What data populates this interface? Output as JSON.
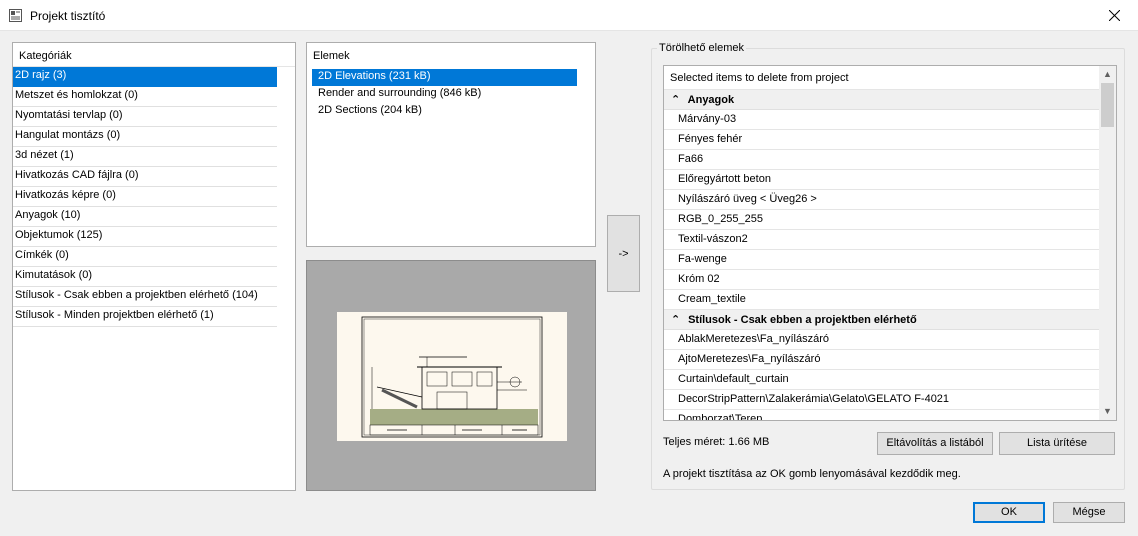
{
  "window": {
    "title": "Projekt tisztító",
    "close_icon": "close-icon"
  },
  "categories": {
    "header": "Kategóriák",
    "items": [
      "2D rajz (3)",
      "Metszet és homlokzat (0)",
      "Nyomtatási tervlap (0)",
      "Hangulat montázs (0)",
      "3d nézet (1)",
      "Hivatkozás CAD fájlra (0)",
      "Hivatkozás képre (0)",
      "Anyagok (10)",
      "Objektumok (125)",
      "Címkék (0)",
      "Kimutatások (0)",
      "Stílusok - Csak ebben a projektben elérhető (104)",
      "Stílusok - Minden projektben elérhető (1)"
    ],
    "selected_index": 0
  },
  "elements": {
    "header": "Elemek",
    "items": [
      "2D Elevations (231 kB)",
      "Render and surrounding (846 kB)",
      "2D Sections (204 kB)"
    ],
    "selected_index": 0
  },
  "move_button": {
    "label": "->"
  },
  "deletable": {
    "group_label": "Törölhető elemek",
    "header": "Selected items to delete from project",
    "groups": [
      {
        "name": "Anyagok",
        "items": [
          "Márvány-03",
          "Fényes fehér",
          "Fa66",
          "Előregyártott beton",
          "Nyílászáró üveg < Üveg26 >",
          "RGB_0_255_255",
          "Textil-vászon2",
          "Fa-wenge",
          "Króm 02",
          "Cream_textile"
        ]
      },
      {
        "name": "Stílusok - Csak ebben a projektben elérhető",
        "items": [
          "AblakMeretezes\\Fa_nyílászáró",
          "AjtoMeretezes\\Fa_nyílászáró",
          "Curtain\\default_curtain",
          "DecorStripPattern\\Zalakerámia\\Gelato\\GELATO F-4021",
          "Domborzat\\Terep"
        ]
      }
    ],
    "total_size": "Teljes méret: 1.66 MB",
    "remove_button": "Eltávolítás a listából",
    "clear_button": "Lista ürítése",
    "note": "A projekt tisztítása az OK gomb lenyomásával kezdődik meg."
  },
  "footer": {
    "ok": "OK",
    "cancel": "Mégse"
  },
  "colors": {
    "selection": "#0078d7",
    "dialog_bg": "#f0f0f0",
    "preview_bg": "#a9a9a9"
  }
}
